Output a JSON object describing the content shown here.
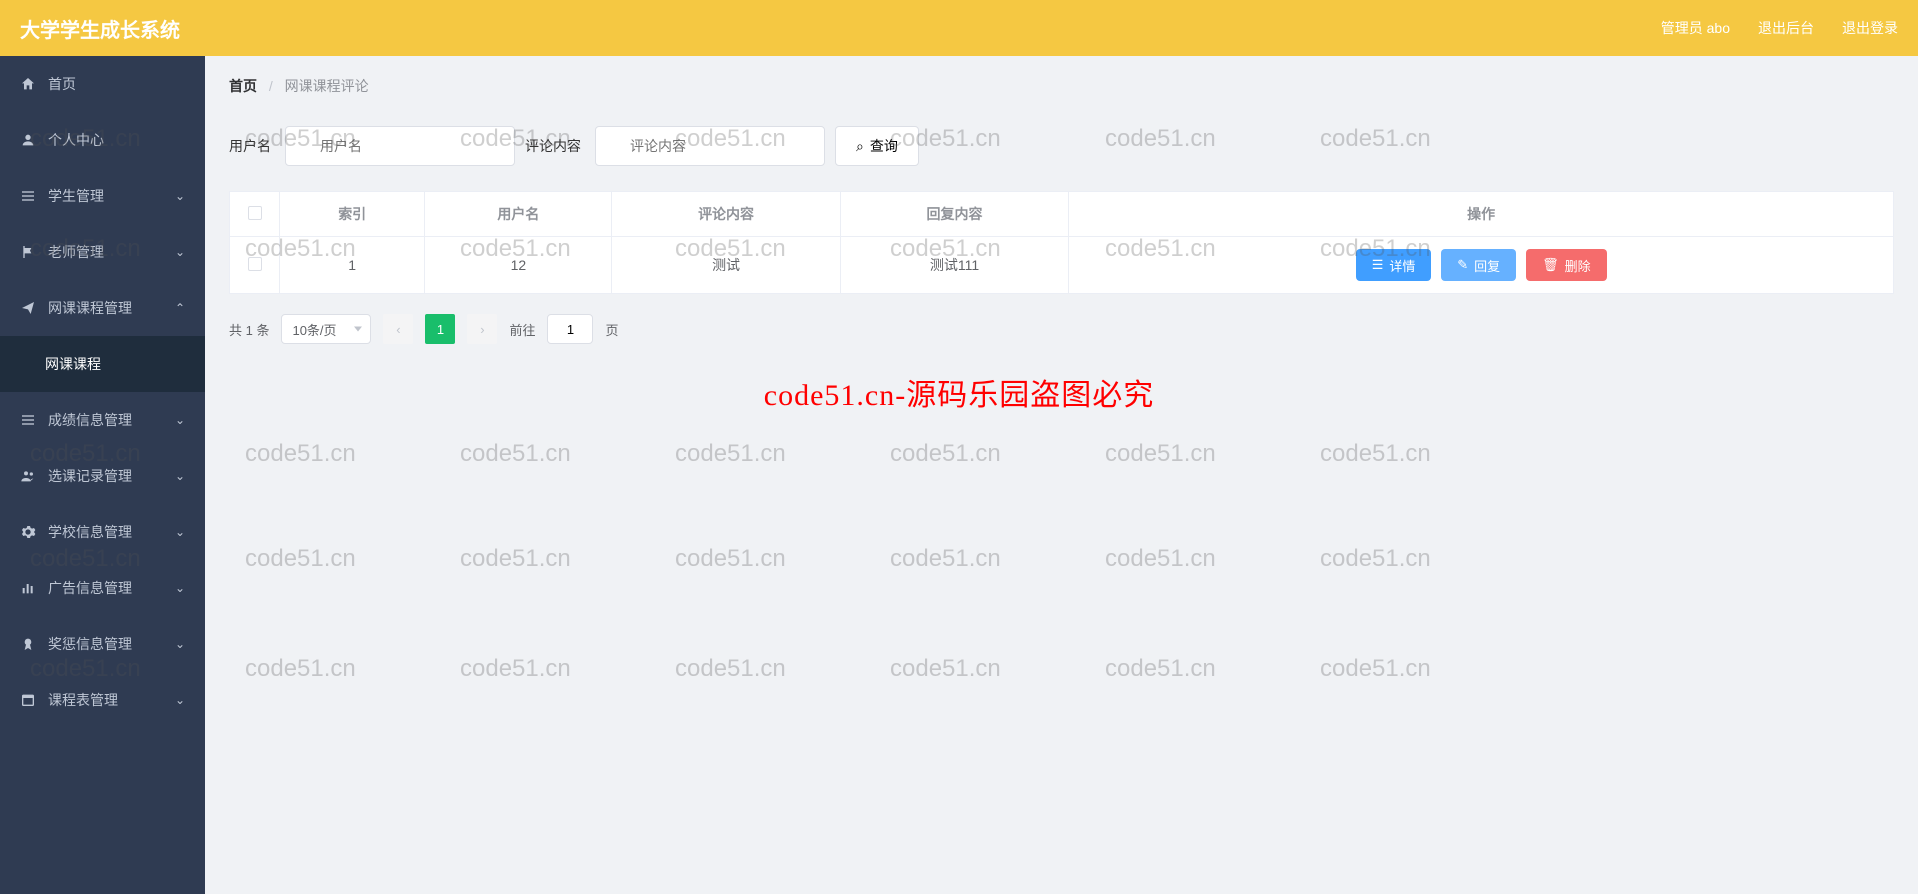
{
  "header": {
    "title": "大学学生成长系统",
    "user_label": "管理员 abo",
    "exit_backend": "退出后台",
    "logout": "退出登录"
  },
  "sidebar": {
    "items": [
      {
        "label": "首页",
        "icon": "home"
      },
      {
        "label": "个人中心",
        "icon": "user"
      },
      {
        "label": "学生管理",
        "icon": "list",
        "expandable": true
      },
      {
        "label": "老师管理",
        "icon": "flag",
        "expandable": true
      },
      {
        "label": "网课课程管理",
        "icon": "send",
        "expandable": true,
        "expanded": true,
        "children": [
          {
            "label": "网课课程"
          }
        ]
      },
      {
        "label": "成绩信息管理",
        "icon": "list",
        "expandable": true
      },
      {
        "label": "选课记录管理",
        "icon": "users",
        "expandable": true
      },
      {
        "label": "学校信息管理",
        "icon": "gear",
        "expandable": true
      },
      {
        "label": "广告信息管理",
        "icon": "chart",
        "expandable": true
      },
      {
        "label": "奖惩信息管理",
        "icon": "award",
        "expandable": true
      },
      {
        "label": "课程表管理",
        "icon": "calendar",
        "expandable": true
      }
    ]
  },
  "breadcrumb": {
    "home": "首页",
    "current": "网课课程评论"
  },
  "search": {
    "username_label": "用户名",
    "username_placeholder": "用户名",
    "comment_label": "评论内容",
    "comment_placeholder": "评论内容",
    "query_btn": "查询"
  },
  "table": {
    "headers": {
      "index": "索引",
      "username": "用户名",
      "comment": "评论内容",
      "reply": "回复内容",
      "action": "操作"
    },
    "rows": [
      {
        "index": "1",
        "username": "12",
        "comment": "测试",
        "reply": "测试111"
      }
    ],
    "actions": {
      "detail": "详情",
      "reply": "回复",
      "delete": "删除"
    }
  },
  "pagination": {
    "total": "共 1 条",
    "per_page": "10条/页",
    "current_page": "1",
    "goto_prefix": "前往",
    "goto_suffix": "页",
    "goto_value": "1"
  },
  "watermark": {
    "text": "code51.cn",
    "red_text": "code51.cn-源码乐园盗图必究"
  }
}
